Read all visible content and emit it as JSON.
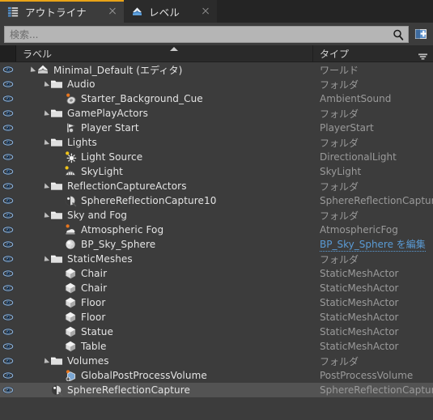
{
  "window": {
    "background_color": "#3c3c3c",
    "accent_color": "#e8a317",
    "selection_color": "#535353",
    "link_color": "#5a9bd5"
  },
  "tabs": [
    {
      "label": "アウトライナ",
      "icon": "outliner-icon",
      "active": true,
      "close_icon": "close-icon"
    },
    {
      "label": "レベル",
      "icon": "level-icon",
      "active": false,
      "close_icon": "close-icon"
    }
  ],
  "search": {
    "placeholder": "検索...",
    "value": "",
    "icon": "search-icon",
    "add_button_icon": "add-actor-icon"
  },
  "columns": {
    "label_header": "ラベル",
    "type_header": "タイプ",
    "sort_icon": "sort-ascending-arrow-icon",
    "filter_icon": "column-filter-icon"
  },
  "rows": [
    {
      "label": "Minimal_Default (エディタ)",
      "type": "ワールド",
      "depth": 0,
      "expander": "expanded",
      "icon": "world-icon",
      "eye": "eye-icon",
      "link": false,
      "selected": false
    },
    {
      "label": "Audio",
      "type": "フォルダ",
      "depth": 1,
      "expander": "expanded",
      "icon": "folder-icon",
      "eye": "eye-icon",
      "link": false,
      "selected": false
    },
    {
      "label": "Starter_Background_Cue",
      "type": "AmbientSound",
      "depth": 2,
      "expander": "none",
      "icon": "ambient-sound-icon",
      "eye": "eye-icon",
      "link": false,
      "selected": false
    },
    {
      "label": "GamePlayActors",
      "type": "フォルダ",
      "depth": 1,
      "expander": "expanded",
      "icon": "folder-icon",
      "eye": "eye-icon",
      "link": false,
      "selected": false
    },
    {
      "label": "Player Start",
      "type": "PlayerStart",
      "depth": 2,
      "expander": "none",
      "icon": "player-start-icon",
      "eye": "eye-icon",
      "link": false,
      "selected": false
    },
    {
      "label": "Lights",
      "type": "フォルダ",
      "depth": 1,
      "expander": "expanded",
      "icon": "folder-icon",
      "eye": "eye-icon",
      "link": false,
      "selected": false
    },
    {
      "label": "Light Source",
      "type": "DirectionalLight",
      "depth": 2,
      "expander": "none",
      "icon": "directional-light-icon",
      "eye": "eye-icon",
      "link": false,
      "selected": false
    },
    {
      "label": "SkyLight",
      "type": "SkyLight",
      "depth": 2,
      "expander": "none",
      "icon": "sky-light-icon",
      "eye": "eye-icon",
      "link": false,
      "selected": false
    },
    {
      "label": "ReflectionCaptureActors",
      "type": "フォルダ",
      "depth": 1,
      "expander": "expanded",
      "icon": "folder-icon",
      "eye": "eye-icon",
      "link": false,
      "selected": false
    },
    {
      "label": "SphereReflectionCapture10",
      "type": "SphereReflectionCapture",
      "depth": 2,
      "expander": "none",
      "icon": "reflection-capture-icon",
      "eye": "eye-icon",
      "link": false,
      "selected": false
    },
    {
      "label": "Sky and Fog",
      "type": "フォルダ",
      "depth": 1,
      "expander": "expanded",
      "icon": "folder-icon",
      "eye": "eye-icon",
      "link": false,
      "selected": false
    },
    {
      "label": "Atmospheric Fog",
      "type": "AtmosphericFog",
      "depth": 2,
      "expander": "none",
      "icon": "atmospheric-fog-icon",
      "eye": "eye-icon",
      "link": false,
      "selected": false
    },
    {
      "label": "BP_Sky_Sphere",
      "type": "BP_Sky_Sphere を編集",
      "depth": 2,
      "expander": "none",
      "icon": "sky-sphere-icon",
      "eye": "eye-icon",
      "link": true,
      "selected": false
    },
    {
      "label": "StaticMeshes",
      "type": "フォルダ",
      "depth": 1,
      "expander": "expanded",
      "icon": "folder-icon",
      "eye": "eye-icon",
      "link": false,
      "selected": false
    },
    {
      "label": "Chair",
      "type": "StaticMeshActor",
      "depth": 2,
      "expander": "none",
      "icon": "static-mesh-icon",
      "eye": "eye-icon",
      "link": false,
      "selected": false
    },
    {
      "label": "Chair",
      "type": "StaticMeshActor",
      "depth": 2,
      "expander": "none",
      "icon": "static-mesh-icon",
      "eye": "eye-icon",
      "link": false,
      "selected": false
    },
    {
      "label": "Floor",
      "type": "StaticMeshActor",
      "depth": 2,
      "expander": "none",
      "icon": "static-mesh-icon",
      "eye": "eye-icon",
      "link": false,
      "selected": false
    },
    {
      "label": "Floor",
      "type": "StaticMeshActor",
      "depth": 2,
      "expander": "none",
      "icon": "static-mesh-icon",
      "eye": "eye-icon",
      "link": false,
      "selected": false
    },
    {
      "label": "Statue",
      "type": "StaticMeshActor",
      "depth": 2,
      "expander": "none",
      "icon": "static-mesh-icon",
      "eye": "eye-icon",
      "link": false,
      "selected": false
    },
    {
      "label": "Table",
      "type": "StaticMeshActor",
      "depth": 2,
      "expander": "none",
      "icon": "static-mesh-icon",
      "eye": "eye-icon",
      "link": false,
      "selected": false
    },
    {
      "label": "Volumes",
      "type": "フォルダ",
      "depth": 1,
      "expander": "expanded",
      "icon": "folder-icon",
      "eye": "eye-icon",
      "link": false,
      "selected": false
    },
    {
      "label": "GlobalPostProcessVolume",
      "type": "PostProcessVolume",
      "depth": 2,
      "expander": "none",
      "icon": "post-process-volume-icon",
      "eye": "eye-icon",
      "link": false,
      "selected": false
    },
    {
      "label": "SphereReflectionCapture",
      "type": "SphereReflectionCapture",
      "depth": 1,
      "expander": "none",
      "icon": "reflection-capture-icon",
      "eye": "eye-icon",
      "link": false,
      "selected": true
    }
  ]
}
